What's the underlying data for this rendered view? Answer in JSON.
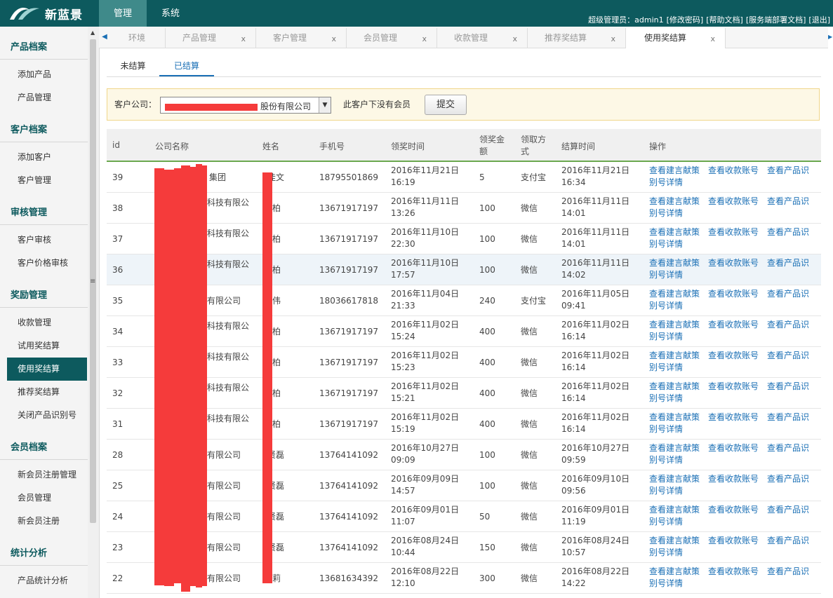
{
  "app": {
    "name": "新蓝景"
  },
  "topnav": [
    {
      "label": "管理",
      "active": true
    },
    {
      "label": "系统",
      "active": false
    }
  ],
  "toplinks": {
    "admin": "超级管理员：admin1",
    "change_pwd": "[修改密码]",
    "help": "[帮助文档]",
    "deploy_doc": "[服务端部署文档]",
    "logout": "[退出]"
  },
  "sidebar": {
    "groups": [
      {
        "title": "产品档案",
        "items": [
          "添加产品",
          "产品管理"
        ]
      },
      {
        "title": "客户档案",
        "items": [
          "添加客户",
          "客户管理"
        ]
      },
      {
        "title": "审核管理",
        "items": [
          "客户审核",
          "客户价格审核"
        ]
      },
      {
        "title": "奖励管理",
        "items": [
          "收款管理",
          "试用奖结算",
          "使用奖结算",
          "推荐奖结算",
          "关闭产品识别号"
        ]
      },
      {
        "title": "会员档案",
        "items": [
          "新会员注册管理",
          "会员管理",
          "新会员注册"
        ]
      },
      {
        "title": "统计分析",
        "items": [
          "产品统计分析"
        ]
      }
    ],
    "active_item": "使用奖结算"
  },
  "tabs": [
    {
      "label": "环境",
      "close": ""
    },
    {
      "label": "产品管理",
      "close": "x"
    },
    {
      "label": "客户管理",
      "close": "x"
    },
    {
      "label": "会员管理",
      "close": "x"
    },
    {
      "label": "收款管理",
      "close": "x"
    },
    {
      "label": "推荐奖结算",
      "close": "x"
    },
    {
      "label": "使用奖结算",
      "close": "x"
    }
  ],
  "subtabs": [
    {
      "label": "未结算",
      "active": false
    },
    {
      "label": "已结算",
      "active": true
    }
  ],
  "filter": {
    "label": "客户公司：",
    "selected": "股份有限公司",
    "message": "此客户下没有会员",
    "submit": "提交"
  },
  "table": {
    "headers": {
      "id": "id",
      "company": "公司名称",
      "name": "姓名",
      "phone": "手机号",
      "receive_time": "领奖时间",
      "amount_l1": "领奖金",
      "amount_l2": "额",
      "method_l1": "领取方",
      "method_l2": "式",
      "settle_time": "结算时间",
      "ops": "操作"
    },
    "op_labels": {
      "proposal_l1": "查看建言献策",
      "proposal_l2": "",
      "account": "查看收款账号",
      "product_l1": "查看产品识",
      "product_l2": "别号详情"
    },
    "rows": [
      {
        "id": "39",
        "company": "集团",
        "name": "佳文",
        "phone": "18795501869",
        "rt1": "2016年11月21日",
        "rt2": "16:19",
        "amount": "5",
        "method": "支付宝",
        "st1": "2016年11月21日",
        "st2": "16:34"
      },
      {
        "id": "38",
        "company": "科技有限公",
        "name": "柏",
        "phone": "13671917197",
        "rt1": "2016年11月11日",
        "rt2": "13:26",
        "amount": "100",
        "method": "微信",
        "st1": "2016年11月11日",
        "st2": "14:01"
      },
      {
        "id": "37",
        "company": "科技有限公",
        "name": "柏",
        "phone": "13671917197",
        "rt1": "2016年11月10日",
        "rt2": "22:30",
        "amount": "100",
        "method": "微信",
        "st1": "2016年11月11日",
        "st2": "14:01"
      },
      {
        "id": "36",
        "company": "科技有限公",
        "name": "柏",
        "phone": "13671917197",
        "rt1": "2016年11月10日",
        "rt2": "17:57",
        "amount": "100",
        "method": "微信",
        "st1": "2016年11月11日",
        "st2": "14:02"
      },
      {
        "id": "35",
        "company": "有限公司",
        "name": "伟",
        "phone": "18036617818",
        "rt1": "2016年11月04日",
        "rt2": "21:33",
        "amount": "240",
        "method": "支付宝",
        "st1": "2016年11月05日",
        "st2": "09:41"
      },
      {
        "id": "34",
        "company": "科技有限公",
        "name": "柏",
        "phone": "13671917197",
        "rt1": "2016年11月02日",
        "rt2": "15:24",
        "amount": "400",
        "method": "微信",
        "st1": "2016年11月02日",
        "st2": "16:14"
      },
      {
        "id": "33",
        "company": "科技有限公",
        "name": "柏",
        "phone": "13671917197",
        "rt1": "2016年11月02日",
        "rt2": "15:23",
        "amount": "400",
        "method": "微信",
        "st1": "2016年11月02日",
        "st2": "16:14"
      },
      {
        "id": "32",
        "company": "科技有限公",
        "name": "柏",
        "phone": "13671917197",
        "rt1": "2016年11月02日",
        "rt2": "15:21",
        "amount": "400",
        "method": "微信",
        "st1": "2016年11月02日",
        "st2": "16:14"
      },
      {
        "id": "31",
        "company": "科技有限公",
        "name": "柏",
        "phone": "13671917197",
        "rt1": "2016年11月02日",
        "rt2": "15:19",
        "amount": "400",
        "method": "微信",
        "st1": "2016年11月02日",
        "st2": "16:14"
      },
      {
        "id": "28",
        "company": "有限公司",
        "name": "贤磊",
        "phone": "13764141092",
        "rt1": "2016年10月27日",
        "rt2": "09:09",
        "amount": "100",
        "method": "微信",
        "st1": "2016年10月27日",
        "st2": "09:59"
      },
      {
        "id": "25",
        "company": "有限公司",
        "name": "贤磊",
        "phone": "13764141092",
        "rt1": "2016年09月09日",
        "rt2": "14:57",
        "amount": "100",
        "method": "微信",
        "st1": "2016年09月10日",
        "st2": "09:56"
      },
      {
        "id": "24",
        "company": "有限公司",
        "name": "贤磊",
        "phone": "13764141092",
        "rt1": "2016年09月01日",
        "rt2": "11:07",
        "amount": "50",
        "method": "微信",
        "st1": "2016年09月01日",
        "st2": "11:19"
      },
      {
        "id": "23",
        "company": "有限公司",
        "name": "贤磊",
        "phone": "13764141092",
        "rt1": "2016年08月24日",
        "rt2": "10:44",
        "amount": "150",
        "method": "微信",
        "st1": "2016年08月24日",
        "st2": "10:57"
      },
      {
        "id": "22",
        "company": "有限公司",
        "name": "莉",
        "phone": "13681634392",
        "rt1": "2016年08月22日",
        "rt2": "12:10",
        "amount": "300",
        "method": "微信",
        "st1": "2016年08月22日",
        "st2": "14:22"
      }
    ]
  },
  "colors": {
    "brand": "#0d5a5e",
    "link": "#1a6fb5",
    "redaction": "#f53b3b"
  }
}
